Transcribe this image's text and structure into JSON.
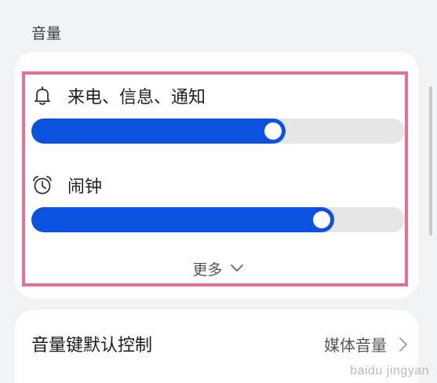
{
  "section": {
    "title": "音量"
  },
  "volume": {
    "ringer": {
      "label": "来电、信息、通知",
      "icon": "bell-icon",
      "level": 0.68
    },
    "alarm": {
      "label": "闹钟",
      "icon": "alarm-clock-icon",
      "level": 0.81
    },
    "more_label": "更多"
  },
  "volume_keys": {
    "label": "音量键默认控制",
    "value": "媒体音量"
  },
  "watermark": "baidu jingyan",
  "colors": {
    "accent": "#0b52e0",
    "highlight": "#ea6f97",
    "track": "#e6e6e6"
  }
}
